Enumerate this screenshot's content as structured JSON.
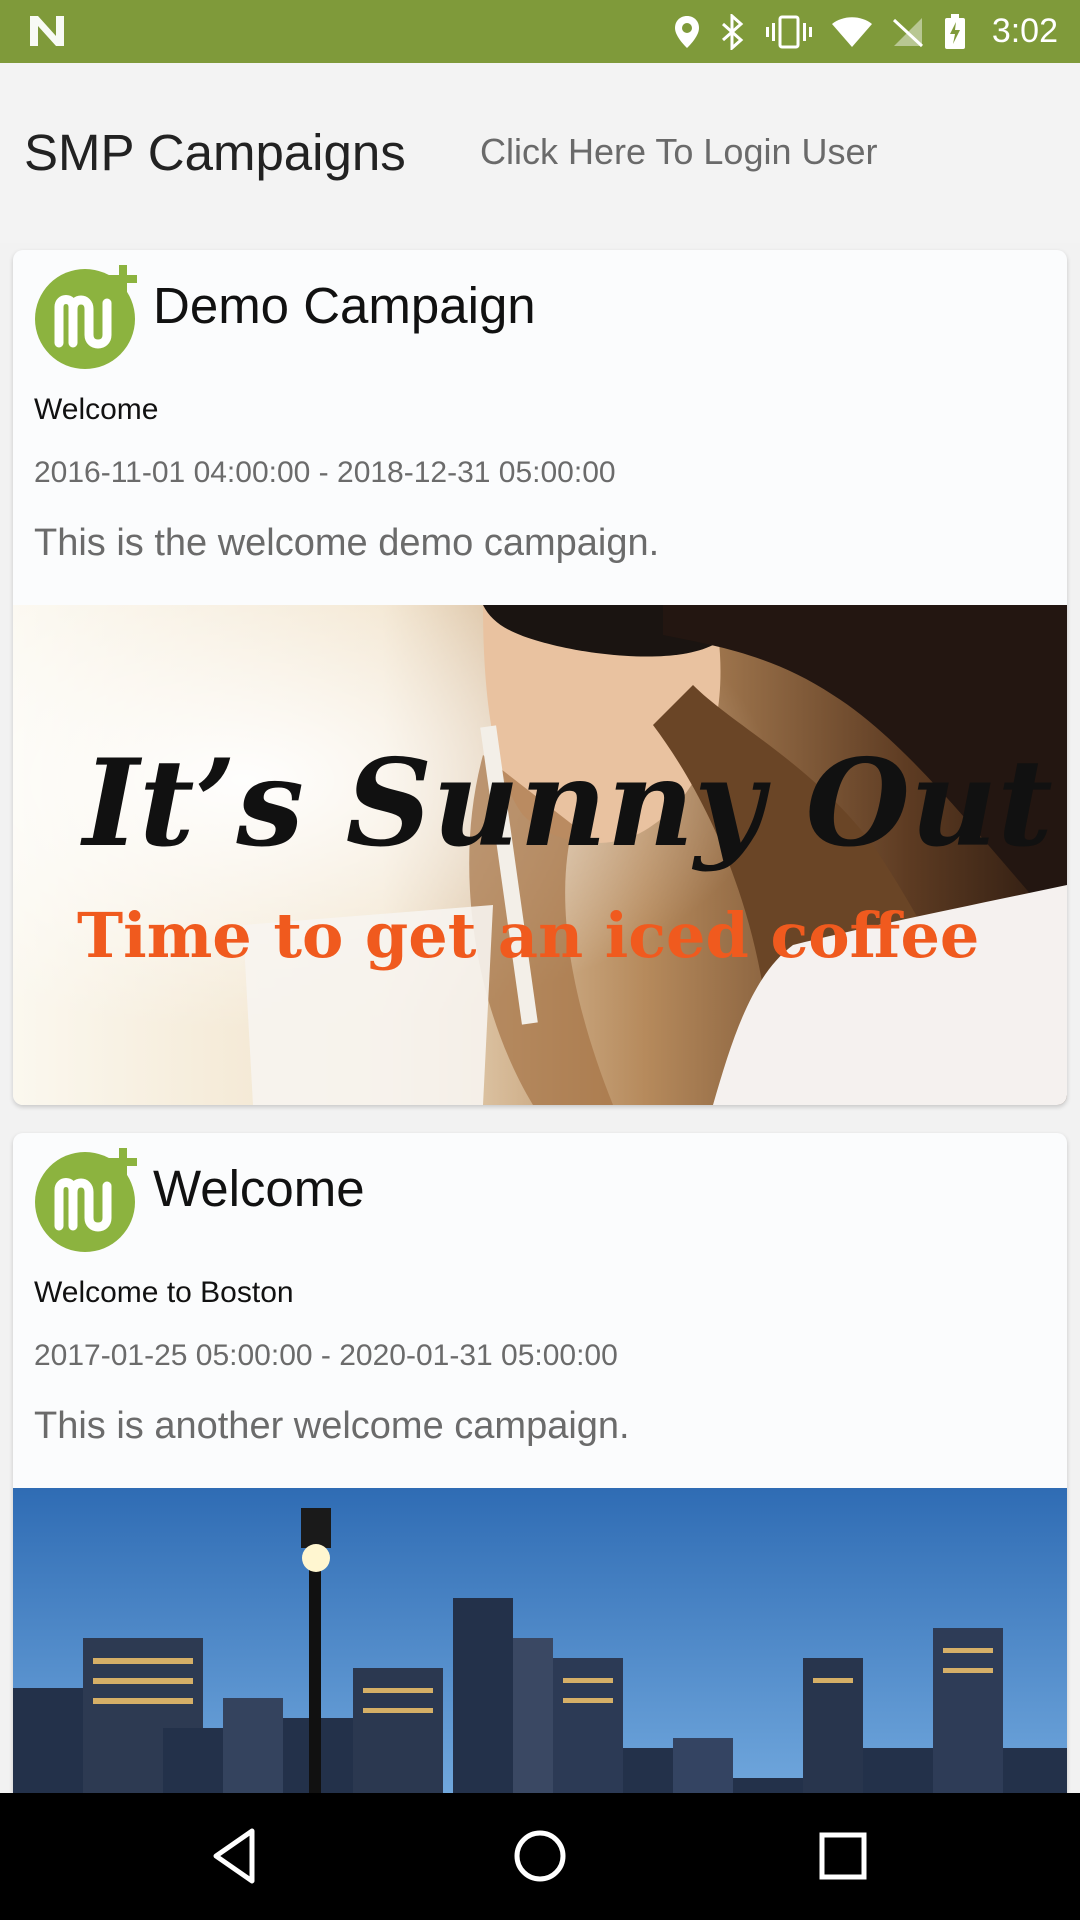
{
  "status_bar": {
    "time": "3:02",
    "icons": [
      "notification-n-icon",
      "location-icon",
      "bluetooth-icon",
      "vibrate-icon",
      "wifi-icon",
      "no-signal-icon",
      "battery-icon"
    ],
    "background": "#7f9a3a"
  },
  "header": {
    "title": "SMP Campaigns",
    "login_link": "Click Here To Login User"
  },
  "campaigns": [
    {
      "title": "Demo Campaign",
      "subtitle": "Welcome",
      "dates": "2016-11-01 04:00:00 - 2018-12-31 05:00:00",
      "description": "This is the welcome demo campaign.",
      "image": {
        "headline": "It’s Sunny Out",
        "tagline": "Time to get an iced coffee"
      }
    },
    {
      "title": "Welcome",
      "subtitle": "Welcome to Boston",
      "dates": "2017-01-25 05:00:00 - 2020-01-31 05:00:00",
      "description": "This is another welcome campaign.",
      "image": {
        "alt": "Boston skyline photo"
      }
    }
  ],
  "nav": {
    "buttons": [
      "back-icon",
      "home-icon",
      "recents-icon"
    ]
  },
  "colors": {
    "brand_green": "#8cb33f",
    "tagline_orange": "#f05a1e"
  }
}
